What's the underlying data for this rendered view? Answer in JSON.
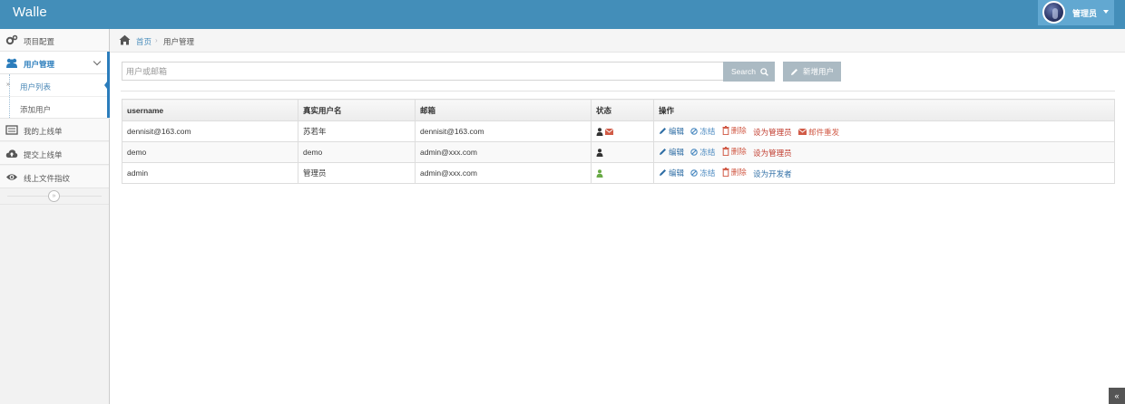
{
  "app": {
    "brand": "Walle"
  },
  "user": {
    "name": "管理员"
  },
  "sidebar": {
    "items": [
      {
        "label": "项目配置",
        "icon": "cogs-icon"
      },
      {
        "label": "用户管理",
        "icon": "users-icon"
      },
      {
        "label": "我的上线单",
        "icon": "list-icon"
      },
      {
        "label": "提交上线单",
        "icon": "cloud-upload-icon"
      },
      {
        "label": "线上文件指纹",
        "icon": "eye-icon"
      }
    ],
    "submenu": [
      {
        "label": "用户列表"
      },
      {
        "label": "添加用户"
      }
    ]
  },
  "breadcrumb": {
    "home": "首页",
    "current": "用户管理"
  },
  "search": {
    "placeholder": "用户或邮箱",
    "value": "",
    "button": "Search"
  },
  "toolbar": {
    "add_user": "新增用户"
  },
  "table": {
    "headers": [
      "username",
      "真实用户名",
      "邮箱",
      "状态",
      "操作"
    ],
    "rows": [
      {
        "username": "dennisit@163.com",
        "realname": "苏若年",
        "email": "dennisit@163.com",
        "status_icons": [
          "user-icon",
          "envelope-icon"
        ],
        "actions": {
          "edit": "编辑",
          "freeze": "冻结",
          "delete": "删除",
          "role": "设为管理员",
          "mail": "邮件重发"
        }
      },
      {
        "username": "demo",
        "realname": "demo",
        "email": "admin@xxx.com",
        "status_icons": [
          "user-icon"
        ],
        "actions": {
          "edit": "编辑",
          "freeze": "冻结",
          "delete": "删除",
          "role": "设为管理员"
        }
      },
      {
        "username": "admin",
        "realname": "管理员",
        "email": "admin@xxx.com",
        "status_icons": [
          "user-green-icon"
        ],
        "actions": {
          "edit": "编辑",
          "freeze": "冻结",
          "delete": "删除",
          "role": "设为开发者"
        }
      }
    ]
  },
  "colors": {
    "navbar": "#438eb9",
    "link": "#4c8fbd",
    "danger": "#d15b47",
    "button_grey": "#abbac3",
    "status_green": "#69aa46"
  }
}
